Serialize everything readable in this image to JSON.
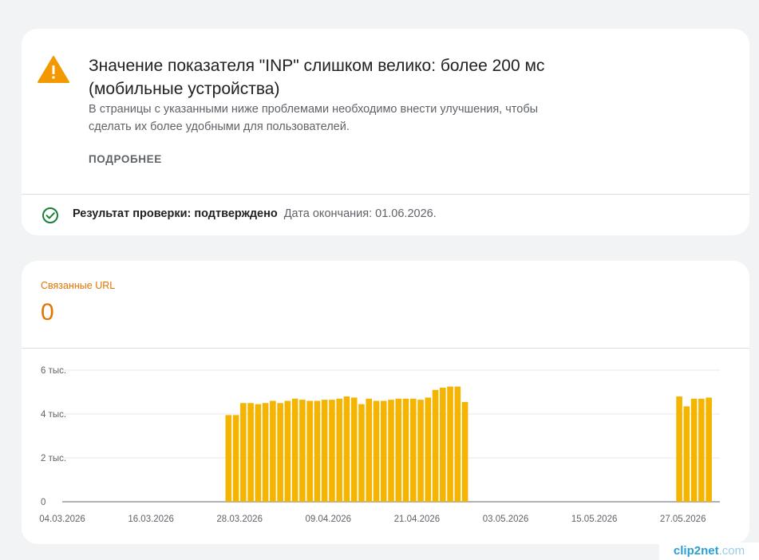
{
  "issue": {
    "title": "Значение показателя \"INP\" слишком велико: более 200 мс (мобильные устройства)",
    "description": "В страницы с указанными ниже проблемами необходимо внести улучшения, чтобы сделать их более удобными для пользователей.",
    "more_label": "ПОДРОБНЕЕ",
    "status_label": "Результат проверки: подтверждено",
    "status_date": "Дата окончания: 01.06.2026.",
    "warning_color": "#f29900",
    "success_color": "#188038"
  },
  "metric": {
    "label": "Связанные URL",
    "value": "0",
    "accent_color": "#e37400"
  },
  "chart_data": {
    "type": "bar",
    "color": "#f4b400",
    "y_ticks": [
      "0",
      "2 тыс.",
      "4 тыс.",
      "6 тыс."
    ],
    "ylim": [
      0,
      6000
    ],
    "x_ticks": [
      "04.03.2026",
      "16.03.2026",
      "28.03.2026",
      "09.04.2026",
      "21.04.2026",
      "03.05.2026",
      "15.05.2026",
      "27.05.2026"
    ],
    "grid": true,
    "start_date": "2026-03-04",
    "end_date": "2026-06-01",
    "series": [
      {
        "points": [
          [
            "2026-03-26",
            3950
          ],
          [
            "2026-03-27",
            3950
          ],
          [
            "2026-03-28",
            4500
          ],
          [
            "2026-03-29",
            4500
          ],
          [
            "2026-03-30",
            4450
          ],
          [
            "2026-03-31",
            4500
          ],
          [
            "2026-04-01",
            4600
          ],
          [
            "2026-04-02",
            4500
          ],
          [
            "2026-04-03",
            4600
          ],
          [
            "2026-04-04",
            4700
          ],
          [
            "2026-04-05",
            4650
          ],
          [
            "2026-04-06",
            4600
          ],
          [
            "2026-04-07",
            4600
          ],
          [
            "2026-04-08",
            4650
          ],
          [
            "2026-04-09",
            4650
          ],
          [
            "2026-04-10",
            4700
          ],
          [
            "2026-04-11",
            4800
          ],
          [
            "2026-04-12",
            4750
          ],
          [
            "2026-04-13",
            4450
          ],
          [
            "2026-04-14",
            4700
          ],
          [
            "2026-04-15",
            4600
          ],
          [
            "2026-04-16",
            4600
          ],
          [
            "2026-04-17",
            4650
          ],
          [
            "2026-04-18",
            4700
          ],
          [
            "2026-04-19",
            4700
          ],
          [
            "2026-04-20",
            4700
          ],
          [
            "2026-04-21",
            4650
          ],
          [
            "2026-04-22",
            4750
          ],
          [
            "2026-04-23",
            5100
          ],
          [
            "2026-04-24",
            5200
          ],
          [
            "2026-04-25",
            5250
          ],
          [
            "2026-04-26",
            5250
          ],
          [
            "2026-04-27",
            4550
          ],
          [
            "2026-05-26",
            4800
          ],
          [
            "2026-05-27",
            4350
          ],
          [
            "2026-05-28",
            4700
          ],
          [
            "2026-05-29",
            4700
          ],
          [
            "2026-05-30",
            4750
          ]
        ]
      }
    ]
  },
  "watermark": {
    "brand": "clip2net",
    "domain": ".com"
  }
}
